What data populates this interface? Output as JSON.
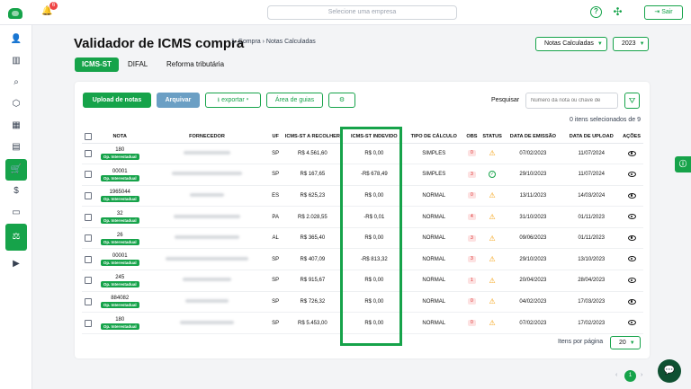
{
  "topbar": {
    "notifications_count": "6",
    "company_placeholder": "Selecione uma empresa",
    "logout_label": "Sair"
  },
  "page": {
    "title": "Validador de ICMS compra",
    "breadcrumb": "1. Compra  ›  Notas Calculadas",
    "notas_select": "Notas Calculadas",
    "year_select": "2023"
  },
  "tabs": [
    {
      "label": "ICMS-ST"
    },
    {
      "label": "DIFAL"
    },
    {
      "label": "Reforma tributária"
    }
  ],
  "toolbar": {
    "upload_label": "Upload de notas",
    "archive_label": "Arquivar",
    "export_label": "exportar",
    "guides_label": "Área de guias",
    "search_label": "Pesquisar",
    "search_placeholder": "Número da nota ou chave de",
    "selected_count": "0 itens selecionados de 9"
  },
  "table": {
    "headers": [
      "NOTA",
      "FORNECEDOR",
      "UF",
      "ICMS-ST A RECOLHER",
      "ICMS-ST INDEVIDO",
      "TIPO DE CÁLCULO",
      "OBS",
      "STATUS",
      "DATA DE EMISSÃO",
      "DATA DE UPLOAD",
      "AÇÕES"
    ],
    "rows": [
      {
        "nota": "180",
        "badge": "Op. Interestadual",
        "uf": "SP",
        "recolher": "R$ 4.561,60",
        "indevido": "R$ 0,00",
        "tipo": "SIMPLES",
        "obs": "0",
        "emissao": "07/02/2023",
        "upload": "11/07/2024"
      },
      {
        "nota": "00001",
        "badge": "Op. Interestadual",
        "uf": "SP",
        "recolher": "R$ 167,65",
        "indevido": "-R$ 678,49",
        "tipo": "SIMPLES",
        "obs": "3",
        "emissao": "29/10/2023",
        "upload": "11/07/2024"
      },
      {
        "nota": "1965044",
        "badge": "Op. Interestadual",
        "uf": "ES",
        "recolher": "R$ 625,23",
        "indevido": "R$ 0,00",
        "tipo": "NORMAL",
        "obs": "0",
        "emissao": "13/11/2023",
        "upload": "14/03/2024"
      },
      {
        "nota": "32",
        "badge": "Op. Interestadual",
        "uf": "PA",
        "recolher": "R$ 2.028,55",
        "indevido": "-R$ 0,01",
        "tipo": "NORMAL",
        "obs": "4",
        "emissao": "31/10/2023",
        "upload": "01/11/2023"
      },
      {
        "nota": "26",
        "badge": "Op. Interestadual",
        "uf": "AL",
        "recolher": "R$ 365,40",
        "indevido": "R$ 0,00",
        "tipo": "NORMAL",
        "obs": "3",
        "emissao": "09/06/2023",
        "upload": "01/11/2023"
      },
      {
        "nota": "00001",
        "badge": "Op. Interestadual",
        "uf": "SP",
        "recolher": "R$ 407,09",
        "indevido": "-R$ 813,32",
        "tipo": "NORMAL",
        "obs": "3",
        "emissao": "29/10/2023",
        "upload": "13/10/2023"
      },
      {
        "nota": "245",
        "badge": "Op. Interestadual",
        "uf": "SP",
        "recolher": "R$ 915,67",
        "indevido": "R$ 0,00",
        "tipo": "NORMAL",
        "obs": "1",
        "emissao": "20/04/2023",
        "upload": "28/04/2023"
      },
      {
        "nota": "884082",
        "badge": "Op. Interestadual",
        "uf": "SP",
        "recolher": "R$ 726,32",
        "indevido": "R$ 0,00",
        "tipo": "NORMAL",
        "obs": "0",
        "emissao": "04/02/2023",
        "upload": "17/03/2023"
      },
      {
        "nota": "180",
        "badge": "Op. Interestadual",
        "uf": "SP",
        "recolher": "R$ 5.453,00",
        "indevido": "R$ 0,00",
        "tipo": "NORMAL",
        "obs": "0",
        "emissao": "07/02/2023",
        "upload": "17/02/2023"
      }
    ]
  },
  "pagination": {
    "per_page_label": "Itens por página",
    "per_page_value": "20",
    "current_page": "1"
  },
  "colors": {
    "accent": "#16a34a",
    "archive": "#6b9fc4"
  }
}
